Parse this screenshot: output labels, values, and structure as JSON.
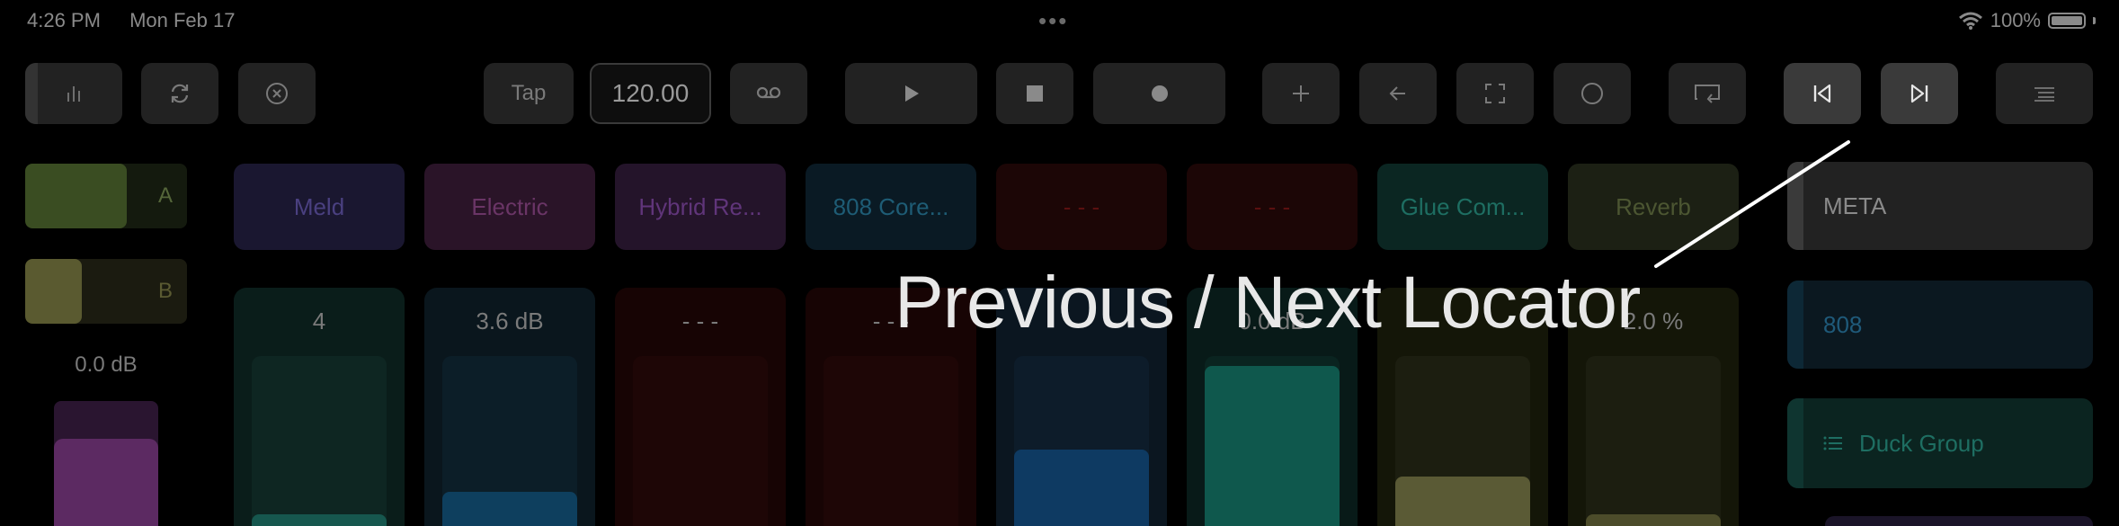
{
  "status_bar": {
    "time": "4:26 PM",
    "date": "Mon Feb 17",
    "battery": "100%",
    "multitask_dots": "•••"
  },
  "toolbar": {
    "tap_label": "Tap",
    "tempo": "120.00",
    "icons": [
      "mixer-icon",
      "loop-icon",
      "close-circle-icon",
      "cassette-icon",
      "play-icon",
      "stop-icon",
      "record-icon",
      "plus-icon",
      "back-arrow-icon",
      "fullscreen-icon",
      "circle-icon",
      "capture-icon",
      "previous-locator-icon",
      "next-locator-icon",
      "menu-icon"
    ]
  },
  "left": {
    "a_label": "A",
    "b_label": "B",
    "db_value": "0.0 dB",
    "a_level": 0.63,
    "b_level": 0.35,
    "meter_level": 0.7
  },
  "devices": [
    {
      "name": "Meld",
      "bg": "#1a1730",
      "color": "#4a4080"
    },
    {
      "name": "Electric",
      "bg": "#2a1428",
      "color": "#6a3566"
    },
    {
      "name": "Hybrid Re...",
      "bg": "#24142a",
      "color": "#60357a"
    },
    {
      "name": "808 Core...",
      "bg": "#0a1a24",
      "color": "#1e5c75"
    },
    {
      "name": "- - -",
      "bg": "#1c0606",
      "color": "#5a1010"
    },
    {
      "name": "- - -",
      "bg": "#1c0606",
      "color": "#5a1010"
    },
    {
      "name": "Glue Com...",
      "bg": "#0b2622",
      "color": "#1e6e62"
    },
    {
      "name": "Reverb",
      "bg": "#1c2014",
      "color": "#4c5632"
    }
  ],
  "faders": [
    {
      "value": "4",
      "bg": "#0a1d1a",
      "track": "#0e2622",
      "fill": "#16574e",
      "level": 0.07
    },
    {
      "value": "3.6 dB",
      "bg": "#0a161d",
      "track": "#0c1e28",
      "fill": "#0e3f5e",
      "level": 0.2
    },
    {
      "value": "- - -",
      "bg": "#170404",
      "track": "#1e0606",
      "fill": "#1e0606",
      "level": 0
    },
    {
      "value": "- - -",
      "bg": "#170404",
      "track": "#1e0606",
      "fill": "#1e0606",
      "level": 0
    },
    {
      "value": "",
      "bg": "#0b1620",
      "track": "#0d1c2a",
      "fill": "#0e3a62",
      "level": 0.45
    },
    {
      "value": "0.0 dB",
      "bg": "#081a18",
      "track": "#0a2420",
      "fill": "#0f584d",
      "level": 0.94
    },
    {
      "value": "",
      "bg": "#141608",
      "track": "#1c1e10",
      "fill": "#5a5a35",
      "level": 0.29
    },
    {
      "value": "2.0 %",
      "bg": "#141608",
      "track": "#1c1e10",
      "fill": "#4c4c2a",
      "level": 0.07
    }
  ],
  "right": {
    "meta": "META",
    "track_808": "808",
    "duck_group": "Duck Group",
    "duck_icon": "list-icon"
  },
  "overlay": {
    "label": "Previous / Next Locator",
    "line_color": "#ffffff"
  }
}
